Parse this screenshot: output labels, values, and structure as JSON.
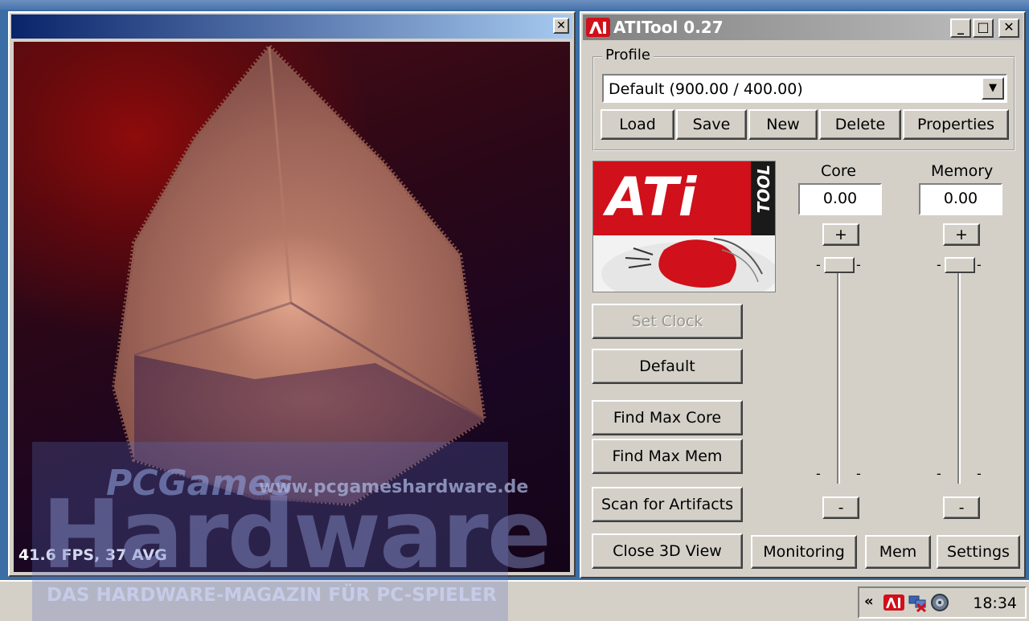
{
  "view3d": {
    "close_glyph": "✕",
    "fps_text": "41.6 FPS, 37 AVG"
  },
  "watermark": {
    "brand_small": "PCGames",
    "url": "www.pcgameshardware.de",
    "brand_big": "Hardware",
    "tagline": "DAS HARDWARE-MAGAZIN FÜR PC-SPIELER"
  },
  "atitool": {
    "title": "ATITool 0.27",
    "minimize_glyph": "_",
    "maximize_glyph": "□",
    "close_glyph": "✕",
    "profile": {
      "label": "Profile",
      "selected": "Default (900.00 / 400.00)",
      "dropdown_glyph": "▼",
      "buttons": {
        "load": "Load",
        "save": "Save",
        "new": "New",
        "delete": "Delete",
        "properties": "Properties"
      }
    },
    "logo": {
      "text": "ATi",
      "side_text": "TOOL"
    },
    "core": {
      "label": "Core",
      "value": "0.00",
      "plus": "+",
      "minus": "-",
      "tick_top_left": "-",
      "tick_top_right": "-",
      "tick_bottom_left": "-",
      "tick_bottom_right": "-"
    },
    "memory": {
      "label": "Memory",
      "value": "0.00",
      "plus": "+",
      "minus": "-",
      "tick_top_left": "-",
      "tick_top_right": "-",
      "tick_bottom_left": "-",
      "tick_bottom_right": "-"
    },
    "actions": {
      "set_clock": "Set Clock",
      "default": "Default",
      "find_max_core": "Find Max Core",
      "find_max_mem": "Find Max Mem",
      "scan_artifacts": "Scan for Artifacts",
      "close_3d_view": "Close 3D View",
      "monitoring": "Monitoring",
      "mem": "Mem",
      "settings": "Settings"
    }
  },
  "taskbar": {
    "tray_chevron": "«",
    "clock": "18:34",
    "tray_icons": [
      "atitool-tray-icon",
      "network-disconnected-icon",
      "volume-icon"
    ]
  },
  "colors": {
    "window_face": "#d4d0c8",
    "active_title": "#0a246a",
    "inactive_title": "#808080",
    "ati_red": "#d0101a"
  }
}
